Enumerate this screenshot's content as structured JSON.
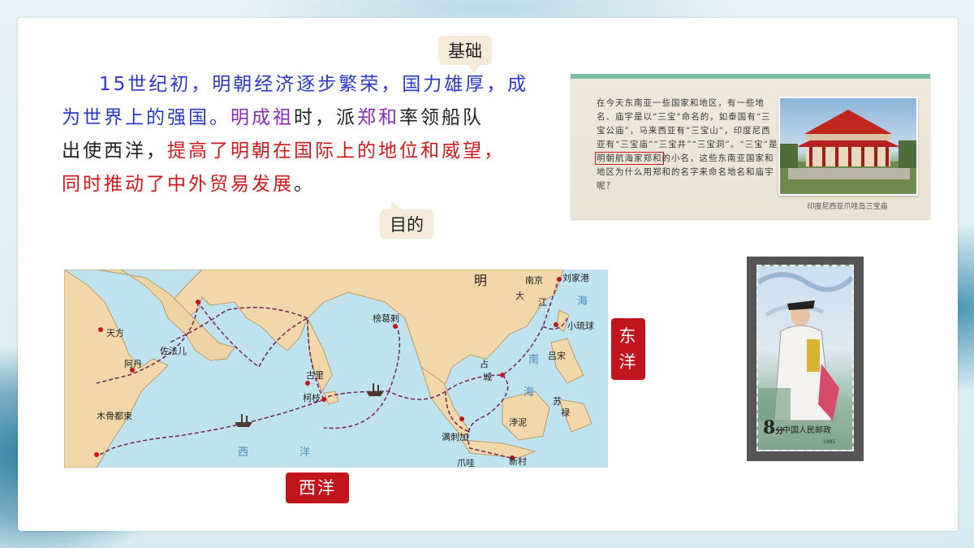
{
  "tags": {
    "basic": "基础",
    "purpose": "目的",
    "east": "东洋",
    "west": "西洋"
  },
  "passage": {
    "seg1": "15世纪初，明朝经济逐步繁荣，国力雄厚，",
    "seg2": "成为世界上的强国。",
    "seg3": "明成祖",
    "seg4": "时，派",
    "seg5": "郑和",
    "seg6": "率领船队",
    "seg7": "出使西洋，",
    "seg8": "提高了明朝在国际上的地位和威望，",
    "seg9": "同时推动了中外贸易发展",
    "seg10": "。"
  },
  "photo": {
    "text_before": "在今天东南亚一些国家和地区，有一些地名、庙宇是以“三宝”命名的，如泰国有“三宝公庙”，马来西亚有“三宝山”，印度尼西亚有“三宝庙”“三宝井”“三宝洞”。“三宝”是",
    "text_highlight": "明朝航海家郑和",
    "text_after": "的小名，这些东南亚国家和地区为什么用郑和的名字来命名地名和庙宇呢？",
    "caption": "印度尼西亚爪哇岛三宝庙"
  },
  "map": {
    "labels": {
      "ming": "明",
      "nanjing": "南京",
      "liujiagang": "刘家港",
      "da": "大",
      "jiang": "江",
      "hai_e": "海",
      "xiaoliuqiu": "小琉球",
      "tianfang": "天方",
      "zuofaer": "佐法儿",
      "adan": "阿丹",
      "banggela": "榜葛剌",
      "zhan": "占",
      "cheng": "城",
      "lvsong": "吕宋",
      "nan": "南",
      "hai_s": "海",
      "guli": "古里",
      "kezhi": "柯枝",
      "su": "苏",
      "lu": "禄",
      "mugudushu": "木骨都束",
      "manlajia": "满刺加",
      "boni": "浡泥",
      "xi": "西",
      "yang": "洋",
      "zhuawa": "爪哇",
      "xincun": "新村"
    }
  },
  "stamp": {
    "value": "8",
    "unit": "分",
    "country": "中国人民邮政",
    "year": "1985"
  },
  "colors": {
    "blue": "#2a37c9",
    "purple": "#8a2bb8",
    "red": "#d0181b",
    "tag_red": "#c1141c",
    "bubble": "#f6ead9"
  }
}
